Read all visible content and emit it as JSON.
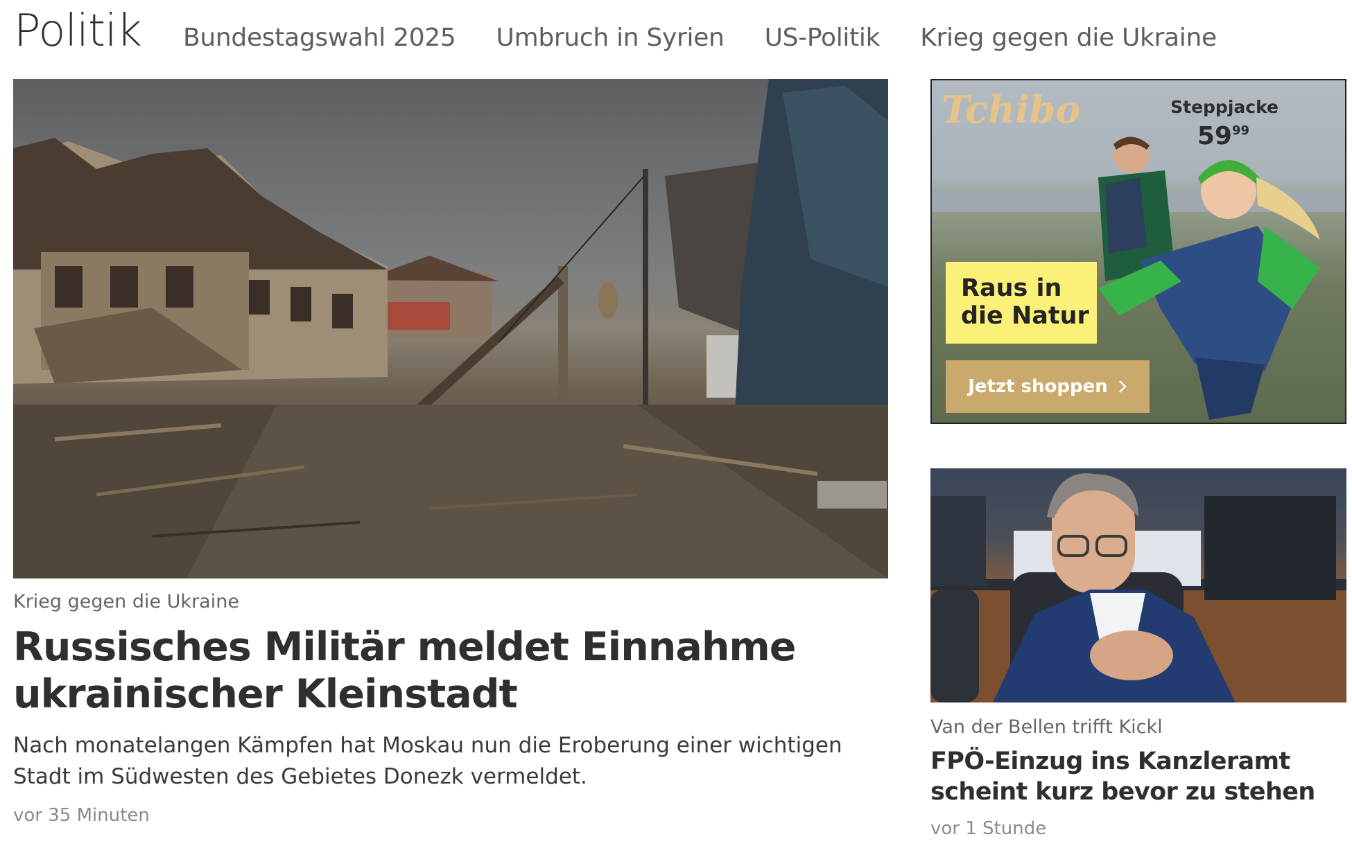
{
  "header": {
    "title": "Politik",
    "nav": [
      {
        "label": "Bundestagswahl 2025"
      },
      {
        "label": "Umbruch in Syrien"
      },
      {
        "label": "US-Politik"
      },
      {
        "label": "Krieg gegen die Ukraine"
      }
    ]
  },
  "main_article": {
    "kicker": "Krieg gegen die Ukraine",
    "headline": "Russisches Militär meldet Einnahme ukrainischer Kleinstadt",
    "teaser": "Nach monatelangen Kämpfen hat Moskau nun die Eroberung einer wichtigen Stadt im Südwesten des Gebietes Donezk vermeldet.",
    "time": "vor 35 Minuten"
  },
  "ad": {
    "brand": "Tchibo",
    "product": "Steppjacke",
    "price_main": "59",
    "price_cents": "99",
    "tagline_line1": "Raus in",
    "tagline_line2": "die Natur",
    "cta": "Jetzt shoppen",
    "cta_icon": "chevron-right-icon",
    "brand_color": "#e7c38a",
    "tagline_bg": "#fbf178",
    "cta_bg": "#c9a96c"
  },
  "side_article": {
    "kicker": "Van der Bellen trifft Kickl",
    "headline": "FPÖ-Einzug ins Kanzleramt scheint kurz bevor zu stehen",
    "time": "vor 1 Stunde"
  }
}
